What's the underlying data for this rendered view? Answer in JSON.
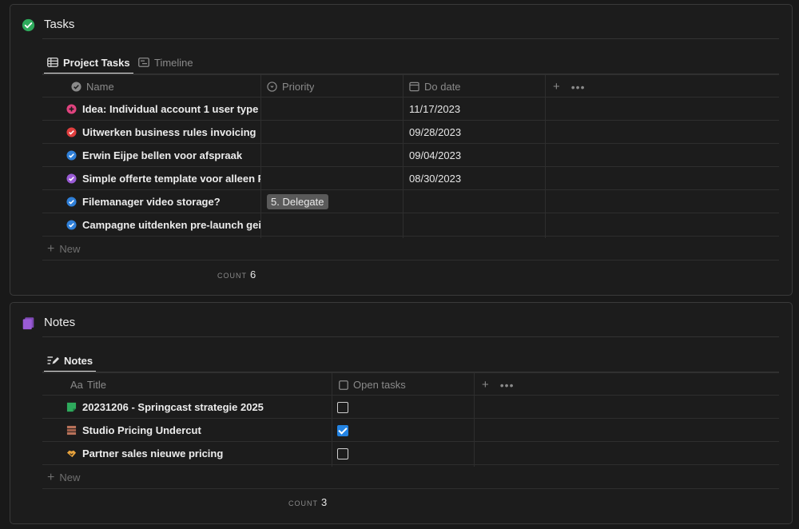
{
  "tasks": {
    "title": "Tasks",
    "tabs": [
      "Project Tasks",
      "Timeline"
    ],
    "columns": [
      "Name",
      "Priority",
      "Do date"
    ],
    "rows": [
      {
        "name": "Idea: Individual account 1 user type",
        "priority": "",
        "date": "11/17/2023",
        "icon": "pink-plus-circle-icon",
        "color": "#e0437f"
      },
      {
        "name": "Uitwerken business rules invoicing",
        "priority": "",
        "date": "09/28/2023",
        "icon": "red-check-circle-icon",
        "color": "#e03e3e"
      },
      {
        "name": "Erwin Eijpe bellen voor afspraak",
        "priority": "",
        "date": "09/04/2023",
        "icon": "blue-check-circle-icon",
        "color": "#2f7fd8"
      },
      {
        "name": "Simple offerte template voor alleen Pro",
        "priority": "",
        "date": "08/30/2023",
        "icon": "purple-check-circle-icon",
        "color": "#9a5bd6"
      },
      {
        "name": "Filemanager video storage?",
        "priority": "5. Delegate",
        "date": "",
        "icon": "blue-check-circle-icon",
        "color": "#2f7fd8"
      },
      {
        "name": "Campagne uitdenken pre-launch geinteresseerden",
        "priority": "",
        "date": "",
        "icon": "blue-check-circle-icon",
        "color": "#2f7fd8"
      }
    ],
    "new_label": "New",
    "count_label": "COUNT",
    "count": "6"
  },
  "notes": {
    "title": "Notes",
    "tabs": [
      "Notes"
    ],
    "columns": [
      "Title",
      "Open tasks"
    ],
    "rows": [
      {
        "title": "20231206 - Springcast strategie 2025",
        "open": false,
        "icon": "green-note-icon"
      },
      {
        "title": "Studio Pricing Undercut",
        "open": true,
        "icon": "brown-stack-icon"
      },
      {
        "title": "Partner sales nieuwe pricing",
        "open": false,
        "icon": "yellow-handshake-icon"
      }
    ],
    "new_label": "New",
    "count_label": "COUNT",
    "count": "3"
  },
  "colors": {
    "accent": "#2383e2",
    "success": "#2eaa5c",
    "notes_icon": "#9a5bd6",
    "badge": "#5a5a5a"
  }
}
